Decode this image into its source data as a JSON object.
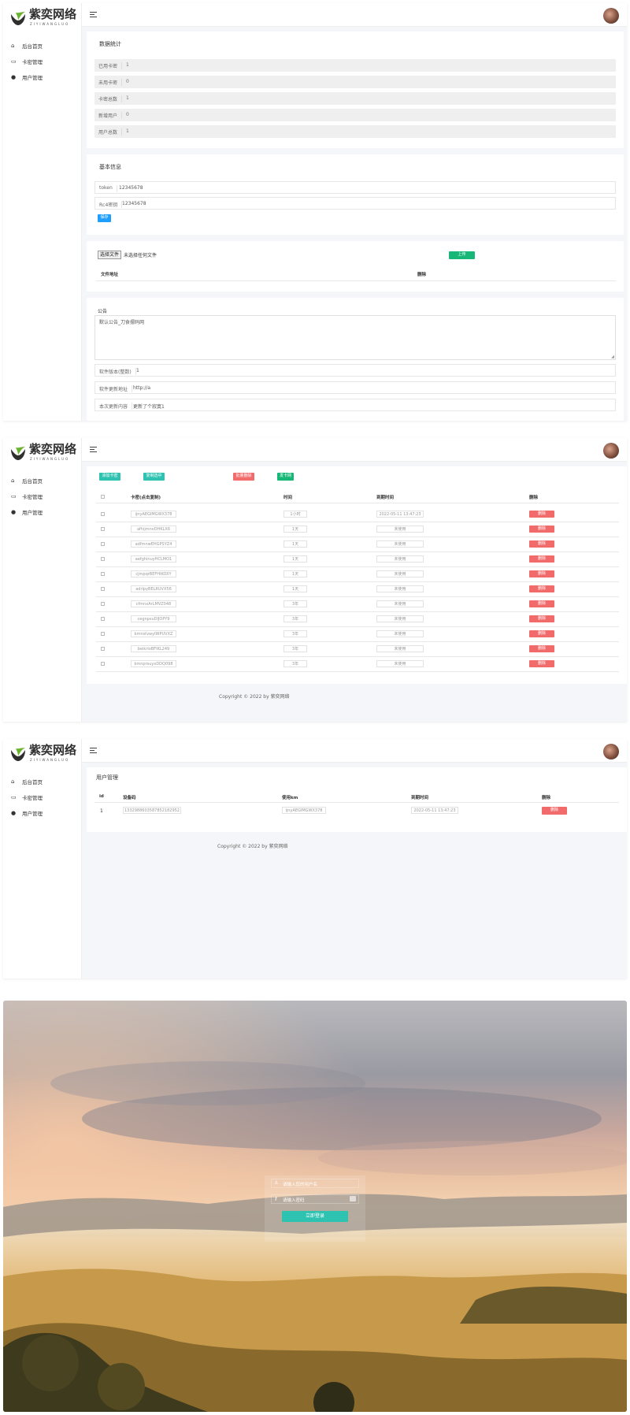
{
  "brand": {
    "title": "紫奕网络",
    "subtitle": "ZIYIWANGLUO"
  },
  "nav": [
    {
      "label": "后台首页",
      "icon": "home-icon"
    },
    {
      "label": "卡密管理",
      "icon": "card-icon"
    },
    {
      "label": "用户管理",
      "icon": "user-icon"
    }
  ],
  "dashboard": {
    "stats_title": "数据统计",
    "stats": [
      {
        "label": "已用卡密",
        "value": "1"
      },
      {
        "label": "未用卡密",
        "value": "0"
      },
      {
        "label": "卡密总数",
        "value": "1"
      },
      {
        "label": "新增用户",
        "value": "0"
      },
      {
        "label": "用户总数",
        "value": "1"
      }
    ],
    "basic_title": "基本信息",
    "token_label": "token",
    "token_value": "12345678",
    "rc4_label": "Rc4密钥",
    "rc4_value": "12345678",
    "save_label": "保存",
    "file_choose_label": "选择文件",
    "file_none_label": "未选择任何文件",
    "upload_label": "上传",
    "file_col_address": "文件地址",
    "file_col_delete": "删除",
    "notice_title": "公告",
    "notice_value": "默认公告_刀食摆码网",
    "version_label": "软件版本(整数)",
    "version_value": "1",
    "update_url_label": "软件更新地址",
    "update_url_value": "http://a",
    "update_content_label": "本次更新内容",
    "update_content_value": "更新了个寂寞1"
  },
  "cards": {
    "add_label": "添加卡密",
    "copy_label": "复制选中",
    "batch_delete_label": "批量删除",
    "issue_label": "发卡网",
    "col_card": "卡密(点击复制)",
    "col_time": "时间",
    "col_expire": "到期时间",
    "col_delete": "删除",
    "delete_label": "删除",
    "rows": [
      {
        "card": "ijnyAEGIMGWX378",
        "time": "1小时",
        "expire": "2022-05-11 13:47:23"
      },
      {
        "card": "afhijmnvDHKLX6",
        "time": "1天",
        "expire": "未使用"
      },
      {
        "card": "adfmnwEHGPSYZ4",
        "time": "1天",
        "expire": "未使用"
      },
      {
        "card": "aefghinuyHCLMO1",
        "time": "1天",
        "expire": "未使用"
      },
      {
        "card": "cjmpqrBEFHIKOXY",
        "time": "1天",
        "expire": "未使用"
      },
      {
        "card": "adrlpyBELRUVX56",
        "time": "1天",
        "expire": "未使用"
      },
      {
        "card": "cfmnxArLMVZ048",
        "time": "3年",
        "expire": "未使用"
      },
      {
        "card": "cegnpsuDIJOPY9",
        "time": "3年",
        "expire": "未使用"
      },
      {
        "card": "kmnstvwyIWPUVXZ",
        "time": "3年",
        "expire": "未使用"
      },
      {
        "card": "beikrloBFIKL249",
        "time": "3年",
        "expire": "未使用"
      },
      {
        "card": "kmnprsuyxDDQ098",
        "time": "3年",
        "expire": "未使用"
      }
    ],
    "footer": "Copyright © 2022 by 紫奕网络"
  },
  "users": {
    "title": "用户管理",
    "col_id": "id",
    "col_device": "设备码",
    "col_km": "使用km",
    "col_expire": "到期时间",
    "col_delete": "删除",
    "delete_label": "删除",
    "rows": [
      {
        "id": "1",
        "device": "1332988603587852182952",
        "km": "ijnyAEGIMGWX378",
        "expire": "2022-05-11 13:47:23"
      }
    ],
    "footer": "Copyright © 2022 by 紫奕网络"
  },
  "login": {
    "user_placeholder": "请输入您的用户名",
    "pass_placeholder": "请输入密码",
    "submit_label": "立即登录"
  },
  "colors": {
    "blue": "#1e9fff",
    "green": "#16b777",
    "teal": "#2ec2b0",
    "red": "#f26b6b"
  }
}
